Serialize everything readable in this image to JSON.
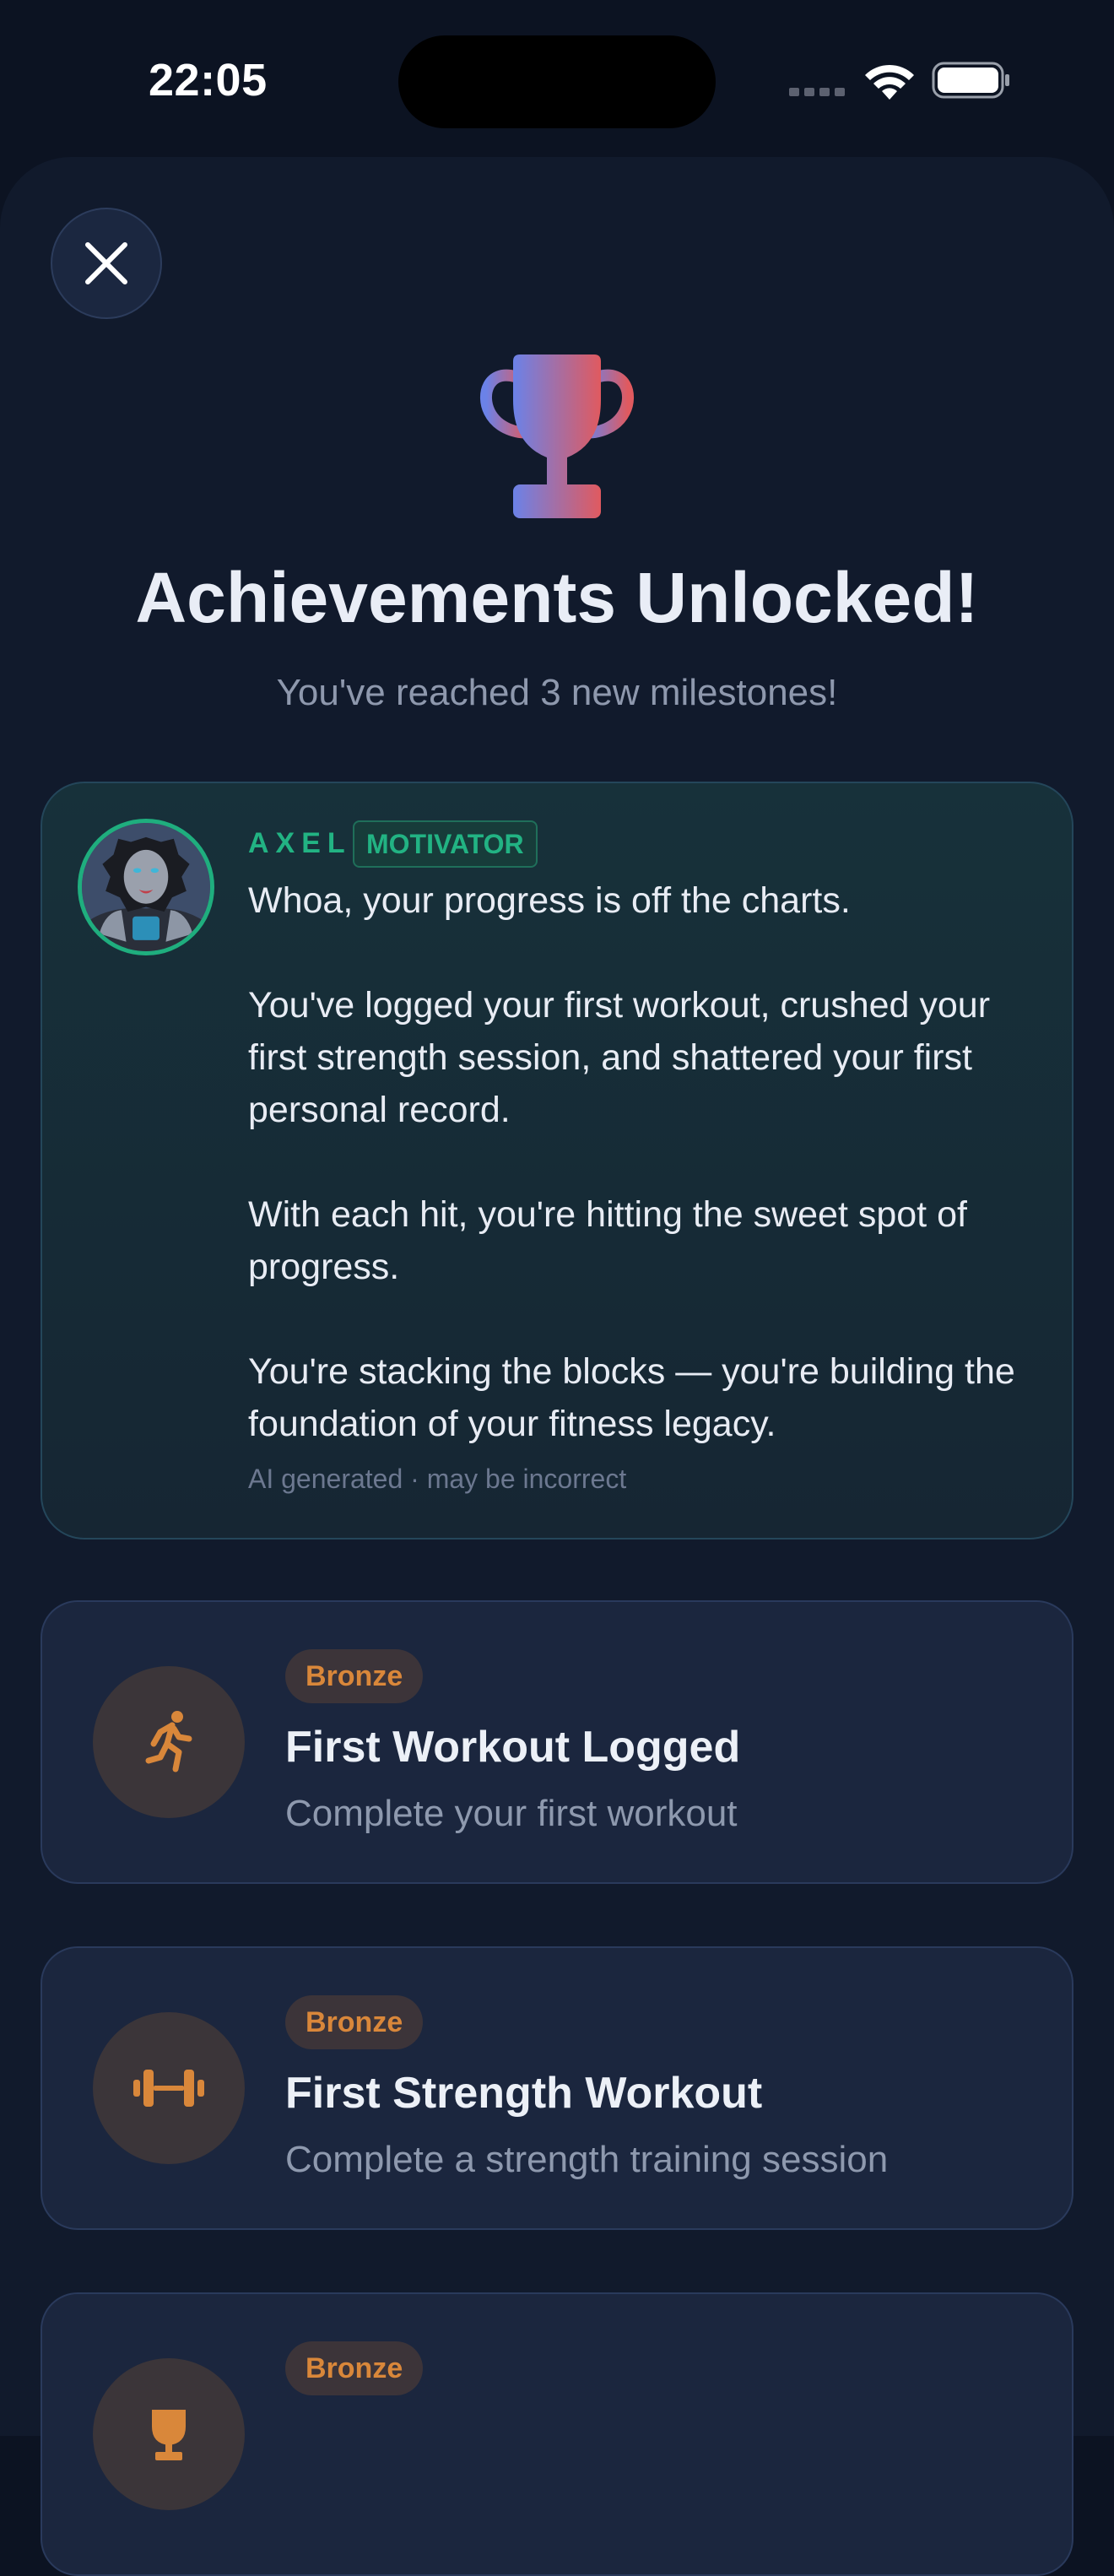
{
  "status_bar": {
    "time": "22:05"
  },
  "header": {
    "title": "Achievements Unlocked!",
    "subtitle": "You've reached 3 new milestones!"
  },
  "coach": {
    "name": "AXEL",
    "role": "MOTIVATOR",
    "message": [
      "Whoa, your progress is off the charts.",
      "You've logged your first workout, crushed your first strength session, and shattered your first personal record.",
      "With each hit, you're hitting the sweet spot of progress.",
      "You're stacking the blocks — you're building the foundation of your fitness legacy."
    ],
    "disclaimer": "AI generated · may be incorrect"
  },
  "achievements": [
    {
      "tier": "Bronze",
      "title": "First Workout Logged",
      "description": "Complete your first workout",
      "icon": "running-icon"
    },
    {
      "tier": "Bronze",
      "title": "First Strength Workout",
      "description": "Complete a strength training session",
      "icon": "dumbbell-icon"
    },
    {
      "tier": "Bronze",
      "title": "",
      "description": "",
      "icon": "trophy-icon"
    }
  ],
  "colors": {
    "accent_green": "#22b383",
    "bronze": "#d9873a",
    "trophy_gradient_start": "#6b82e8",
    "trophy_gradient_end": "#e05a5f",
    "background": "#0c1322",
    "sheet": "#111a2c"
  }
}
